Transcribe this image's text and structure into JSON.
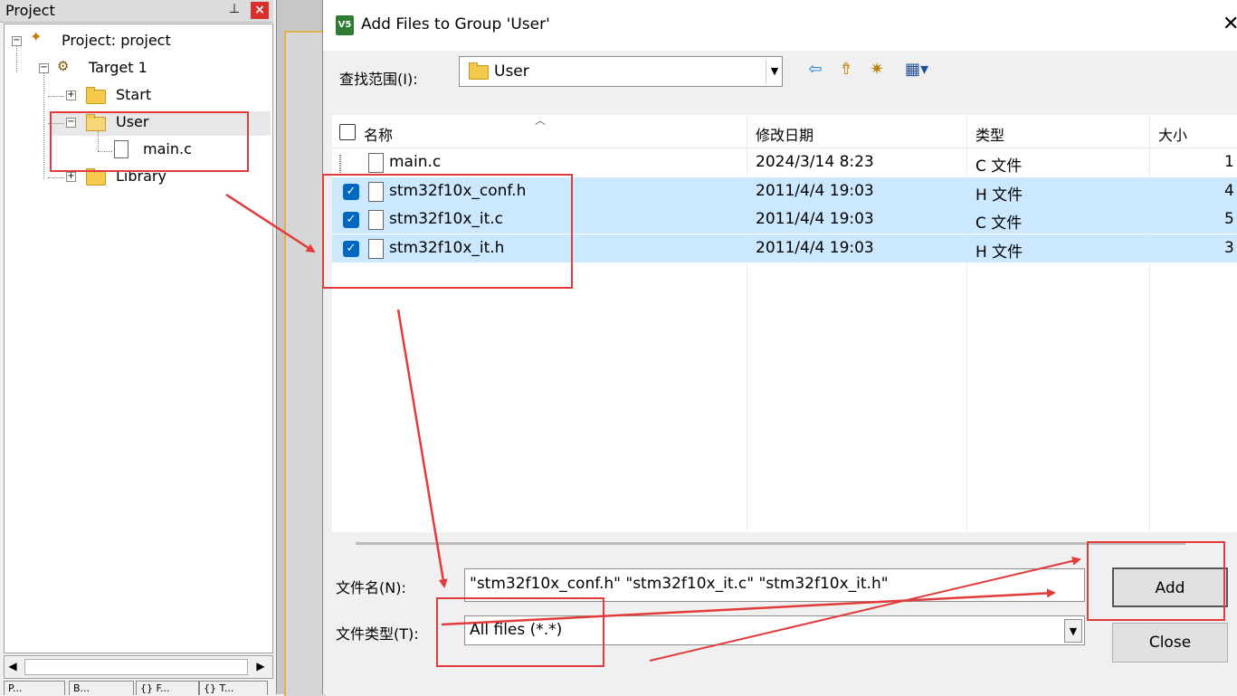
{
  "project_panel": {
    "title": "Project",
    "pin_icon": "pin-icon",
    "close_glyph": "×",
    "tree": {
      "project": "Project: project",
      "target": "Target 1",
      "groups": [
        "Start",
        "User",
        "Library"
      ],
      "user_files": [
        "main.c"
      ]
    },
    "bottom_tabs": [
      "P...",
      "B...",
      "{} F...",
      "{} T..."
    ]
  },
  "dialog": {
    "title": "Add Files to Group 'User'",
    "app_icon_text": "V5",
    "close_glyph": "✕",
    "look_in": {
      "label": "查找范围(I):",
      "value": "User"
    },
    "toolbar_icons": [
      "back-arrow-icon",
      "up-folder-icon",
      "new-folder-icon",
      "view-menu-icon"
    ],
    "columns": [
      "名称",
      "修改日期",
      "类型",
      "大小"
    ],
    "files": [
      {
        "name": "main.c",
        "modified": "2024/3/14 8:23",
        "type": "C 文件",
        "size": "1",
        "selected": false
      },
      {
        "name": "stm32f10x_conf.h",
        "modified": "2011/4/4 19:03",
        "type": "H 文件",
        "size": "4",
        "selected": true
      },
      {
        "name": "stm32f10x_it.c",
        "modified": "2011/4/4 19:03",
        "type": "C 文件",
        "size": "5",
        "selected": true
      },
      {
        "name": "stm32f10x_it.h",
        "modified": "2011/4/4 19:03",
        "type": "H 文件",
        "size": "3",
        "selected": true
      }
    ],
    "file_name": {
      "label": "文件名(N):",
      "value": "\"stm32f10x_conf.h\" \"stm32f10x_it.c\" \"stm32f10x_it.h\""
    },
    "file_type": {
      "label": "文件类型(T):",
      "value": "All files (*.*)"
    },
    "buttons": {
      "add": "Add",
      "close": "Close"
    }
  },
  "colors": {
    "selection": "#cce8ff",
    "checkbox": "#0067c0",
    "annotation": "#e23b3b"
  }
}
